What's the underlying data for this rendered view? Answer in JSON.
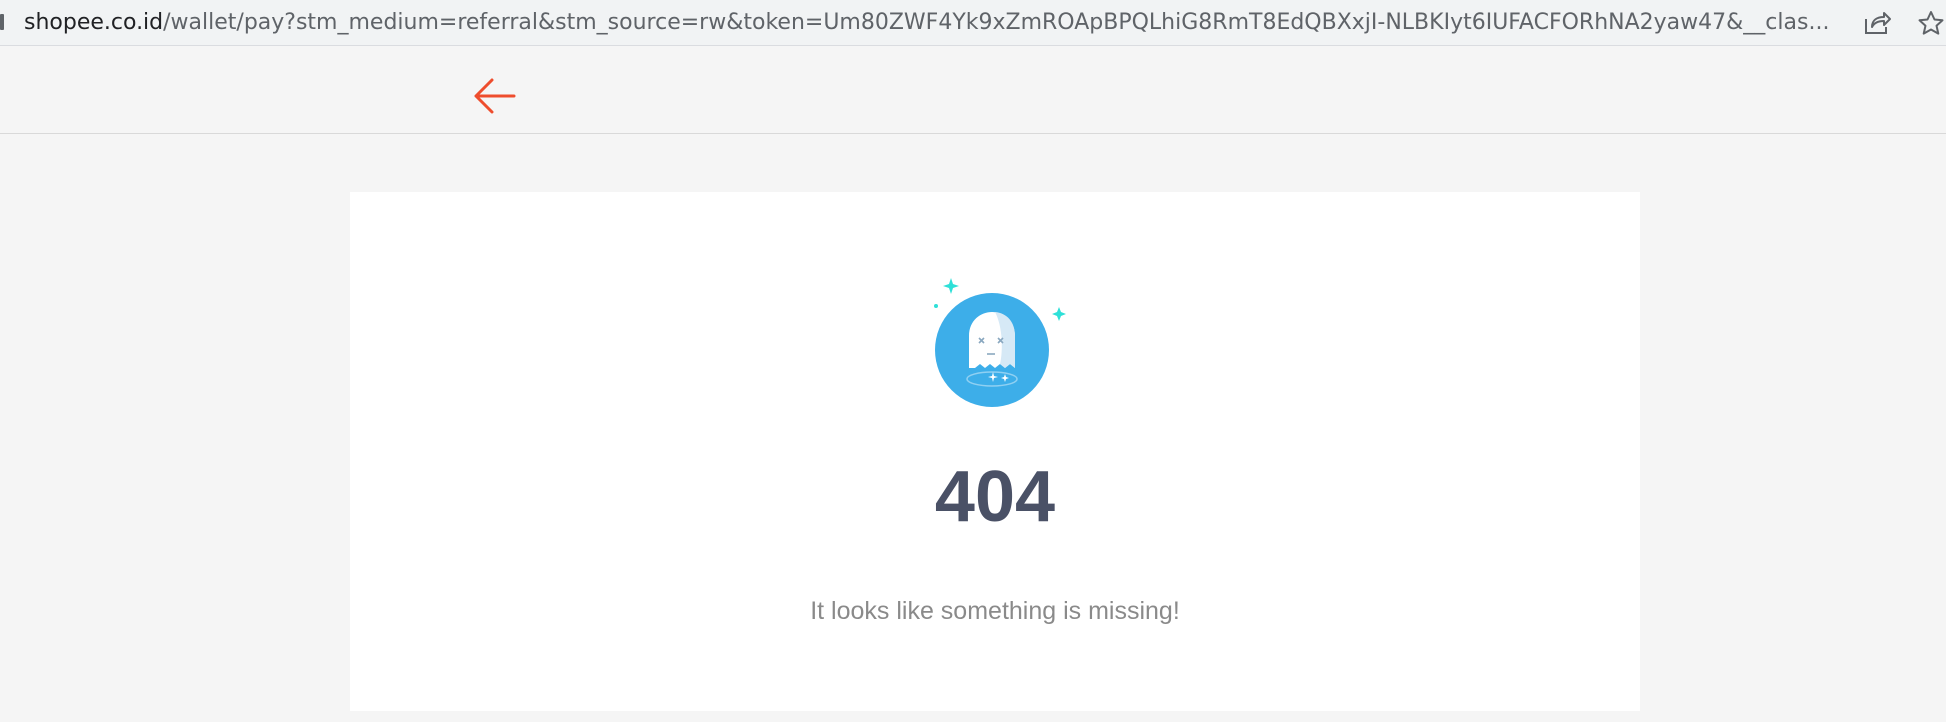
{
  "browser": {
    "url_host": "shopee.co.id",
    "url_path": "/wallet/pay?stm_medium=referral&stm_source=rw&token=Um80ZWF4Yk9xZmROApBPQLhiG8RmT8EdQBXxjI-NLBKIyt6IUFACFORhNA2yaw47&__clas..."
  },
  "header": {
    "back_icon": "arrow-left-icon",
    "accent_color": "#ee4d2d"
  },
  "error": {
    "code": "404",
    "message": "It looks like something is missing!",
    "illustration_icon": "ghost-icon",
    "illustration_color": "#3daee9"
  }
}
